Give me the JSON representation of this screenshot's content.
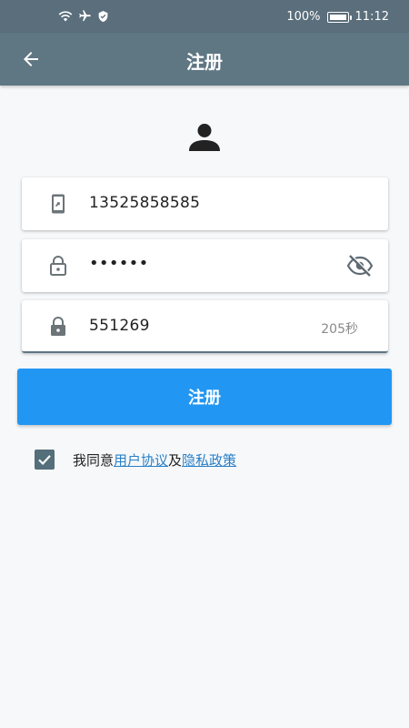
{
  "status_bar": {
    "battery_percent": "100%",
    "time": "11:12",
    "icons": [
      "wifi-icon",
      "airplane-icon",
      "shield-icon",
      "battery-icon"
    ]
  },
  "app_bar": {
    "title": "注册",
    "back_icon": "arrow-left-icon"
  },
  "form": {
    "phone": {
      "value": "13525858585",
      "icon": "phone-icon"
    },
    "password": {
      "value": "••••••",
      "icon": "lock-icon",
      "toggle_icon": "eye-off-icon"
    },
    "code": {
      "value": "551269",
      "icon": "lock-icon",
      "timer": "205秒"
    }
  },
  "submit_label": "注册",
  "agreement": {
    "checked": true,
    "prefix": "我同意",
    "link1": "用户协议",
    "middle": "及",
    "link2": "隐私政策"
  },
  "colors": {
    "app_bar": "#5f7683",
    "status_bar": "#5a6e7b",
    "primary_button": "#2196f3",
    "link": "#2a80c8",
    "checkbox": "#546e7a"
  }
}
